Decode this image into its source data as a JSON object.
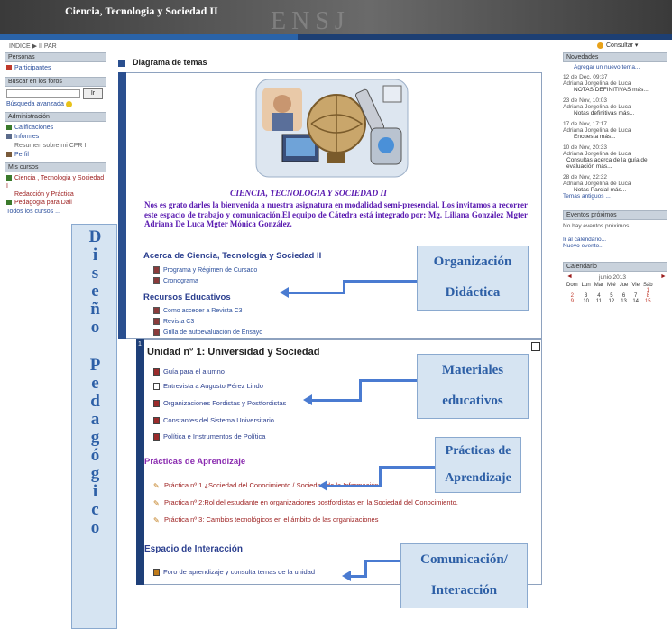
{
  "header": {
    "title": "Ciencia, Tecnologia y Sociedad II",
    "watermark": "ENSJ"
  },
  "breadcrumb": "INDICE ▶ II PAR",
  "language": "Consultar ▾",
  "left": {
    "personas": {
      "head": "Personas",
      "items": [
        "Participantes"
      ]
    },
    "buscar": {
      "head": "Buscar en los foros",
      "button": "Ir",
      "link": "Búsqueda avanzada"
    },
    "admin": {
      "head": "Administración",
      "items": [
        "Calificaciones",
        "Informes",
        "Resumen sobre mi CPR II",
        "Perfil"
      ]
    },
    "cursos": {
      "head": "Mis cursos",
      "items": [
        "Ciencia , Tecnologia y Sociedad I",
        "Redacción y Práctica",
        "Pedagogía para Dall",
        "Todos los cursos ..."
      ]
    }
  },
  "main": {
    "heading": "Diagrama de temas",
    "course_title": "CIENCIA, TECNOLOGIA Y SOCIEDAD II",
    "intro": "Nos es grato darles la bienvenida a nuestra asignatura en modalidad semi-presencial. Los invitamos a recorrer este espacio de trabajo y comunicación.El equipo de Cátedra está integrado por: Mg. Liliana González Mgter Adriana De Luca Mgter Mónica González.",
    "acerca": {
      "title": "Acerca de Ciencia, Tecnología y Sociedad II",
      "items": [
        "Programa y Régimen de Cursado",
        "Cronograma"
      ]
    },
    "recursos": {
      "title": "Recursos Educativos",
      "items": [
        "Como acceder a Revista C3",
        "Revista C3",
        "Grilla de autoevaluación de Ensayo"
      ]
    },
    "unidad": {
      "number": "1",
      "title": "Unidad n° 1: Universidad y Sociedad",
      "items": [
        "Guía para el alumno",
        "Entrevista a Augusto Pérez Lindo",
        "Organizaciones Fordistas y Postfordistas",
        "Constantes del Sistema Universitario",
        "Política e Instrumentos de Política"
      ],
      "practicas_title": "Prácticas de Aprendizaje",
      "practicas": [
        "Práctica nº 1 ¿Sociedad del Conocimiento / Sociedad de la Información?",
        "Practica nº 2:Rol del estudiante en organizaciones postfordistas en la Sociedad del Conocimiento.",
        "Práctica nº 3: Cambios tecnológicos en el ámbito de las organizaciones"
      ],
      "interaccion_title": "Espacio de Interacción",
      "interaccion": [
        "Foro de aprendizaje y consulta temas de la unidad"
      ]
    }
  },
  "callouts": {
    "organizacion": [
      "Organización",
      "Didáctica"
    ],
    "materiales": [
      "Materiales",
      "educativos"
    ],
    "practicas": [
      "Prácticas de",
      "Aprendizaje"
    ],
    "comunicacion": [
      "Comunicación/",
      "Interacción"
    ],
    "diseno": [
      "D",
      "i",
      "s",
      "e",
      "ñ",
      "o",
      "P",
      "e",
      "d",
      "a",
      "g",
      "ó",
      "g",
      "i",
      "c",
      "o"
    ]
  },
  "right": {
    "novedades": {
      "head": "Novedades",
      "add": "Agregar un nuevo tema...",
      "posts": [
        {
          "date": "12 de Dec, 09:37",
          "author": "Adriana Jorgelina de Luca",
          "subject": "NOTAS DEFINITIVAS más..."
        },
        {
          "date": "23 de Nov, 10:03",
          "author": "Adriana Jorgelina de Luca",
          "subject": "Notas definitivas más..."
        },
        {
          "date": "17 de Nov, 17:17",
          "author": "Adriana Jorgelina de Luca",
          "subject": "Encuesta más..."
        },
        {
          "date": "10 de Nov, 20:33",
          "author": "Adriana Jorgelina de Luca",
          "subject": "Consultas acerca de la guía de evaluación más..."
        },
        {
          "date": "28 de Nov, 22:32",
          "author": "Adriana Jorgelina de Luca",
          "subject": "Notas Parcial más..."
        }
      ],
      "older": "Temas antiguos ..."
    },
    "eventos": {
      "head": "Eventos próximos",
      "text": "No hay eventos próximos",
      "links": [
        "Ir al calendario...",
        "Nuevo evento..."
      ]
    },
    "calendario": {
      "head": "Calendario",
      "month": "junio 2013",
      "days": [
        "Dom",
        "Lun",
        "Mar",
        "Mié",
        "Jue",
        "Vie",
        "Sáb"
      ],
      "weeks": [
        [
          "",
          "",
          "",
          "",
          "",
          "",
          "1"
        ],
        [
          "2",
          "3",
          "4",
          "5",
          "6",
          "7",
          "8"
        ],
        [
          "9",
          "10",
          "11",
          "12",
          "13",
          "14",
          "15"
        ]
      ]
    }
  }
}
